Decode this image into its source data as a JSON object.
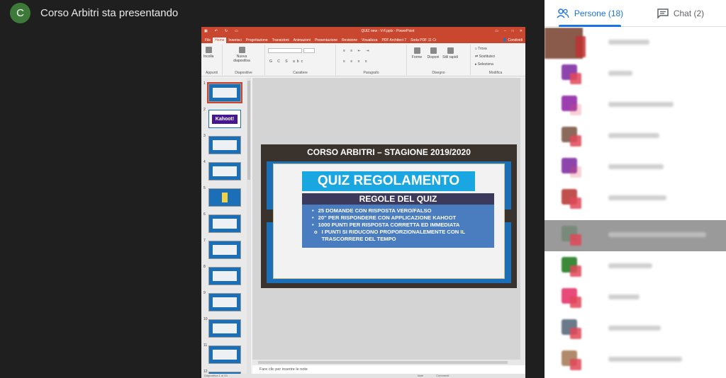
{
  "presenter": {
    "initial": "C",
    "text": "Corso Arbitri sta presentando",
    "avatar_color": "#3d7a3a"
  },
  "ppt": {
    "title": "QUIZ new - V-F.pptx - PowerPoint",
    "tabs": [
      "File",
      "Home",
      "Inserisci",
      "Progettazione",
      "Transizioni",
      "Animazioni",
      "Presentazione",
      "Revisione",
      "Visualizza",
      "PDF Architect 7",
      "Soda PDF 11 Cr"
    ],
    "share_label": "Condividi",
    "ribbon": {
      "paste": "Incolla",
      "new_slide": "Nuova diapositiva",
      "shapes": "Forme",
      "arrange": "Disponi",
      "styles": "Stili rapidi",
      "find": "Trova",
      "replace": "Sostituisci",
      "select": "Seleziona",
      "groups": [
        "Appunti",
        "Diapositive",
        "Carattere",
        "Paragrafo",
        "Disegno",
        "Modifica"
      ]
    },
    "thumb_numbers": [
      "1",
      "2",
      "3",
      "4",
      "5",
      "6",
      "7",
      "8",
      "9",
      "10",
      "11",
      "12"
    ],
    "thumb_kahoot": "Kahoot!",
    "notes_placeholder": "Fare clic per inserire le note",
    "status": [
      "Diapositiva 1 di 53",
      "Note",
      "Commenti"
    ]
  },
  "slide": {
    "header": "CORSO ARBITRI – STAGIONE 2019/2020",
    "title": "QUIZ REGOLAMENTO",
    "rules_title": "REGOLE DEL QUIZ",
    "bullets": [
      "25 DOMANDE CON RISPOSTA VERO/FALSO",
      "20'' PER RISPONDERE CON APPLICAZIONE KAHOOT",
      "1000 PUNTI PER RISPOSTA CORRETTA ED IMMEDIATA"
    ],
    "sub_bullet": "I PUNTI SI RIDUCONO PROPORZIONALEMENTE CON IL TRASCORRERE DEL TEMPO"
  },
  "panel": {
    "people_tab": "Persone (18)",
    "chat_tab": "Chat (2)",
    "accent": "#1a73e8"
  }
}
